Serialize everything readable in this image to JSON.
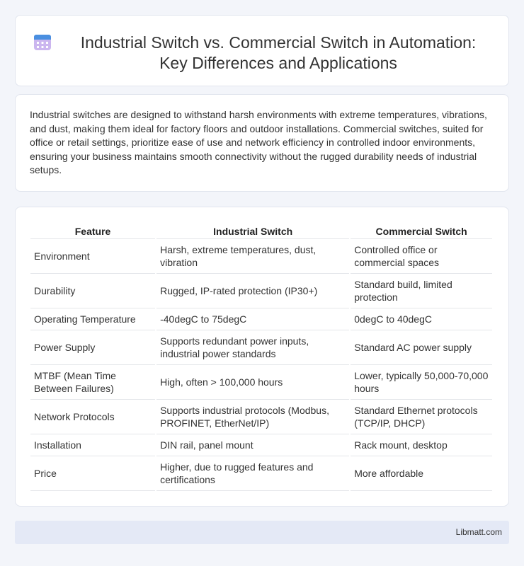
{
  "header": {
    "title": "Industrial Switch vs. Commercial Switch in Automation: Key Differences and Applications",
    "icon": "calendar-grid-icon"
  },
  "intro": {
    "text": "Industrial switches are designed to withstand harsh environments with extreme temperatures, vibrations, and dust, making them ideal for factory floors and outdoor installations. Commercial switches, suited for office or retail settings, prioritize ease of use and network efficiency in controlled indoor environments, ensuring your business maintains smooth connectivity without the rugged durability needs of industrial setups."
  },
  "table": {
    "headers": [
      "Feature",
      "Industrial Switch",
      "Commercial Switch"
    ],
    "rows": [
      [
        "Environment",
        "Harsh, extreme temperatures, dust, vibration",
        "Controlled office or commercial spaces"
      ],
      [
        "Durability",
        "Rugged, IP-rated protection (IP30+)",
        "Standard build, limited protection"
      ],
      [
        "Operating Temperature",
        "-40degC to 75degC",
        "0degC to 40degC"
      ],
      [
        "Power Supply",
        "Supports redundant power inputs, industrial power standards",
        "Standard AC power supply"
      ],
      [
        "MTBF (Mean Time Between Failures)",
        "High, often > 100,000 hours",
        "Lower, typically 50,000-70,000 hours"
      ],
      [
        "Network Protocols",
        "Supports industrial protocols (Modbus, PROFINET, EtherNet/IP)",
        "Standard Ethernet protocols (TCP/IP, DHCP)"
      ],
      [
        "Installation",
        "DIN rail, panel mount",
        "Rack mount, desktop"
      ],
      [
        "Price",
        "Higher, due to rugged features and certifications",
        "More affordable"
      ]
    ]
  },
  "footer": {
    "text": "Libmatt.com"
  },
  "colors": {
    "accent_blue": "#4a8fe0",
    "accent_purple": "#b07ad8",
    "footer_bg": "#e4e9f6"
  }
}
